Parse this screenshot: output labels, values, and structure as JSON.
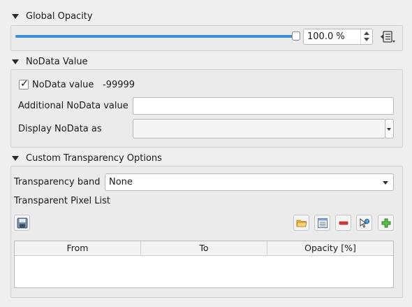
{
  "sections": {
    "global_opacity": {
      "title": "Global Opacity"
    },
    "nodata": {
      "title": "NoData Value"
    },
    "custom_transparency": {
      "title": "Custom Transparency Options"
    }
  },
  "opacity": {
    "value_text": "100.0 %",
    "level_percent": 100
  },
  "nodata": {
    "checkbox_label": "NoData value",
    "checked": true,
    "value": "-99999",
    "additional_label": "Additional NoData value",
    "additional_value": "",
    "display_label": "Display NoData as"
  },
  "transparency": {
    "band_label": "Transparency band",
    "band_value": "None",
    "pixel_list_label": "Transparent Pixel List",
    "table_headers": [
      "From",
      "To",
      "Opacity [%]"
    ]
  },
  "icons": {
    "save": "save-icon",
    "open": "folder-open-icon",
    "defaults": "table-defaults-icon",
    "remove": "remove-icon",
    "from_display": "pick-from-display-icon",
    "add": "add-icon",
    "data_defined": "data-defined-override-icon"
  },
  "colors": {
    "accent": "#3a8fd8",
    "remove_red": "#d83b3b",
    "add_green": "#3a9d3a",
    "folder_yellow": "#e8b23a"
  }
}
